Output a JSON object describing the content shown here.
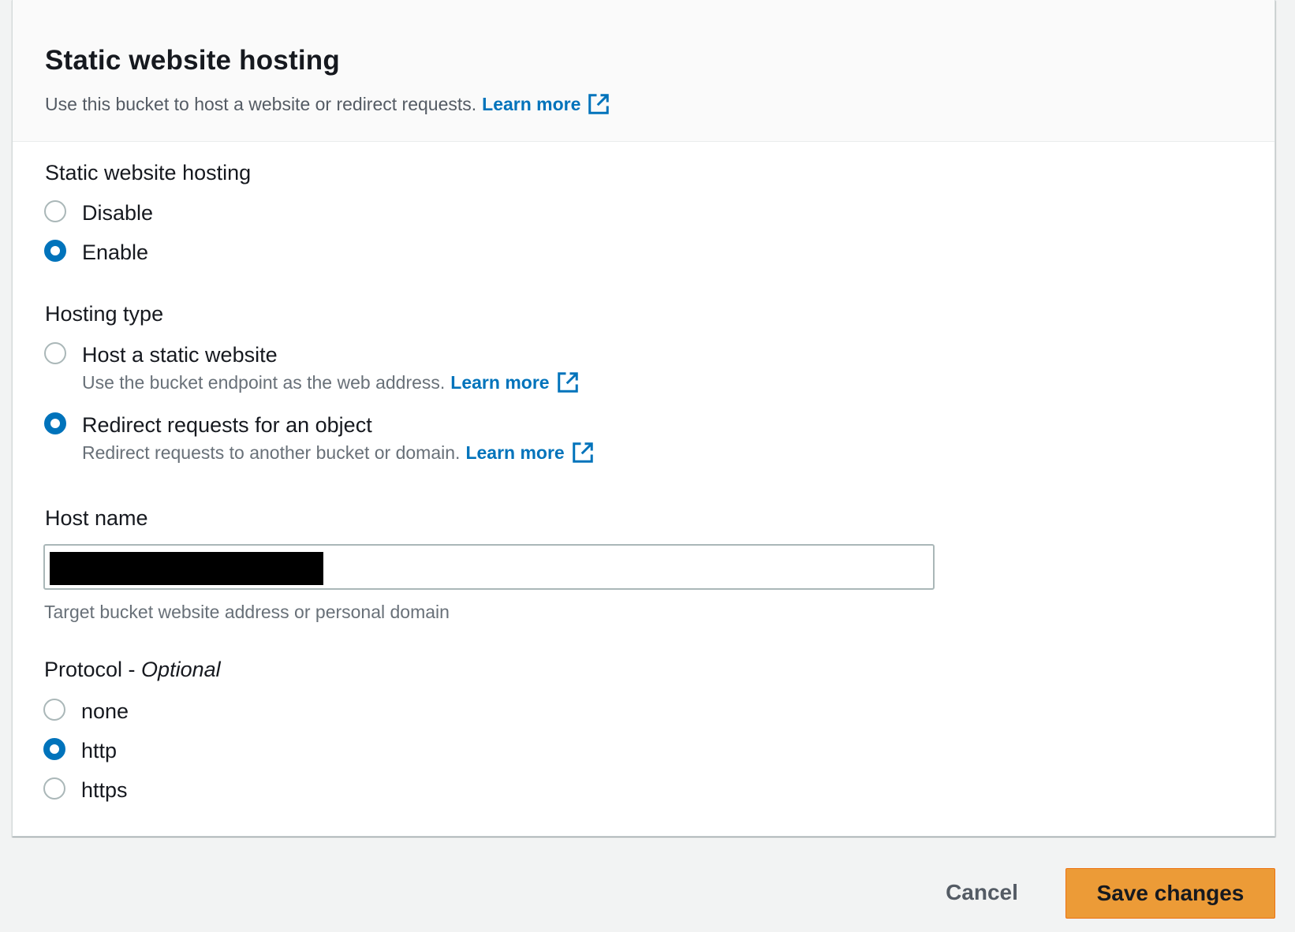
{
  "header": {
    "title": "Static website hosting",
    "description": "Use this bucket to host a website or redirect requests.",
    "learn_more": "Learn more",
    "learn_more_icon": "external-link-icon"
  },
  "hosting": {
    "label": "Static website hosting",
    "options": [
      {
        "label": "Disable",
        "checked": false
      },
      {
        "label": "Enable",
        "checked": true
      }
    ]
  },
  "hosting_type": {
    "label": "Hosting type",
    "options": [
      {
        "label": "Host a static website",
        "description": "Use the bucket endpoint as the web address.",
        "learn_more": "Learn more",
        "checked": false
      },
      {
        "label": "Redirect requests for an object",
        "description": "Redirect requests to another bucket or domain.",
        "learn_more": "Learn more",
        "checked": true
      }
    ]
  },
  "host_name": {
    "label": "Host name",
    "value": "",
    "redacted": true,
    "hint": "Target bucket website address or personal domain"
  },
  "protocol": {
    "label": "Protocol - ",
    "optional": "Optional",
    "options": [
      {
        "label": "none",
        "checked": false
      },
      {
        "label": "http",
        "checked": true
      },
      {
        "label": "https",
        "checked": false
      }
    ]
  },
  "footer": {
    "cancel_label": "Cancel",
    "save_label": "Save changes"
  },
  "colors": {
    "link": "#0073bb",
    "primary_button": "#ec9b37",
    "radio_checked": "#0073bb"
  }
}
